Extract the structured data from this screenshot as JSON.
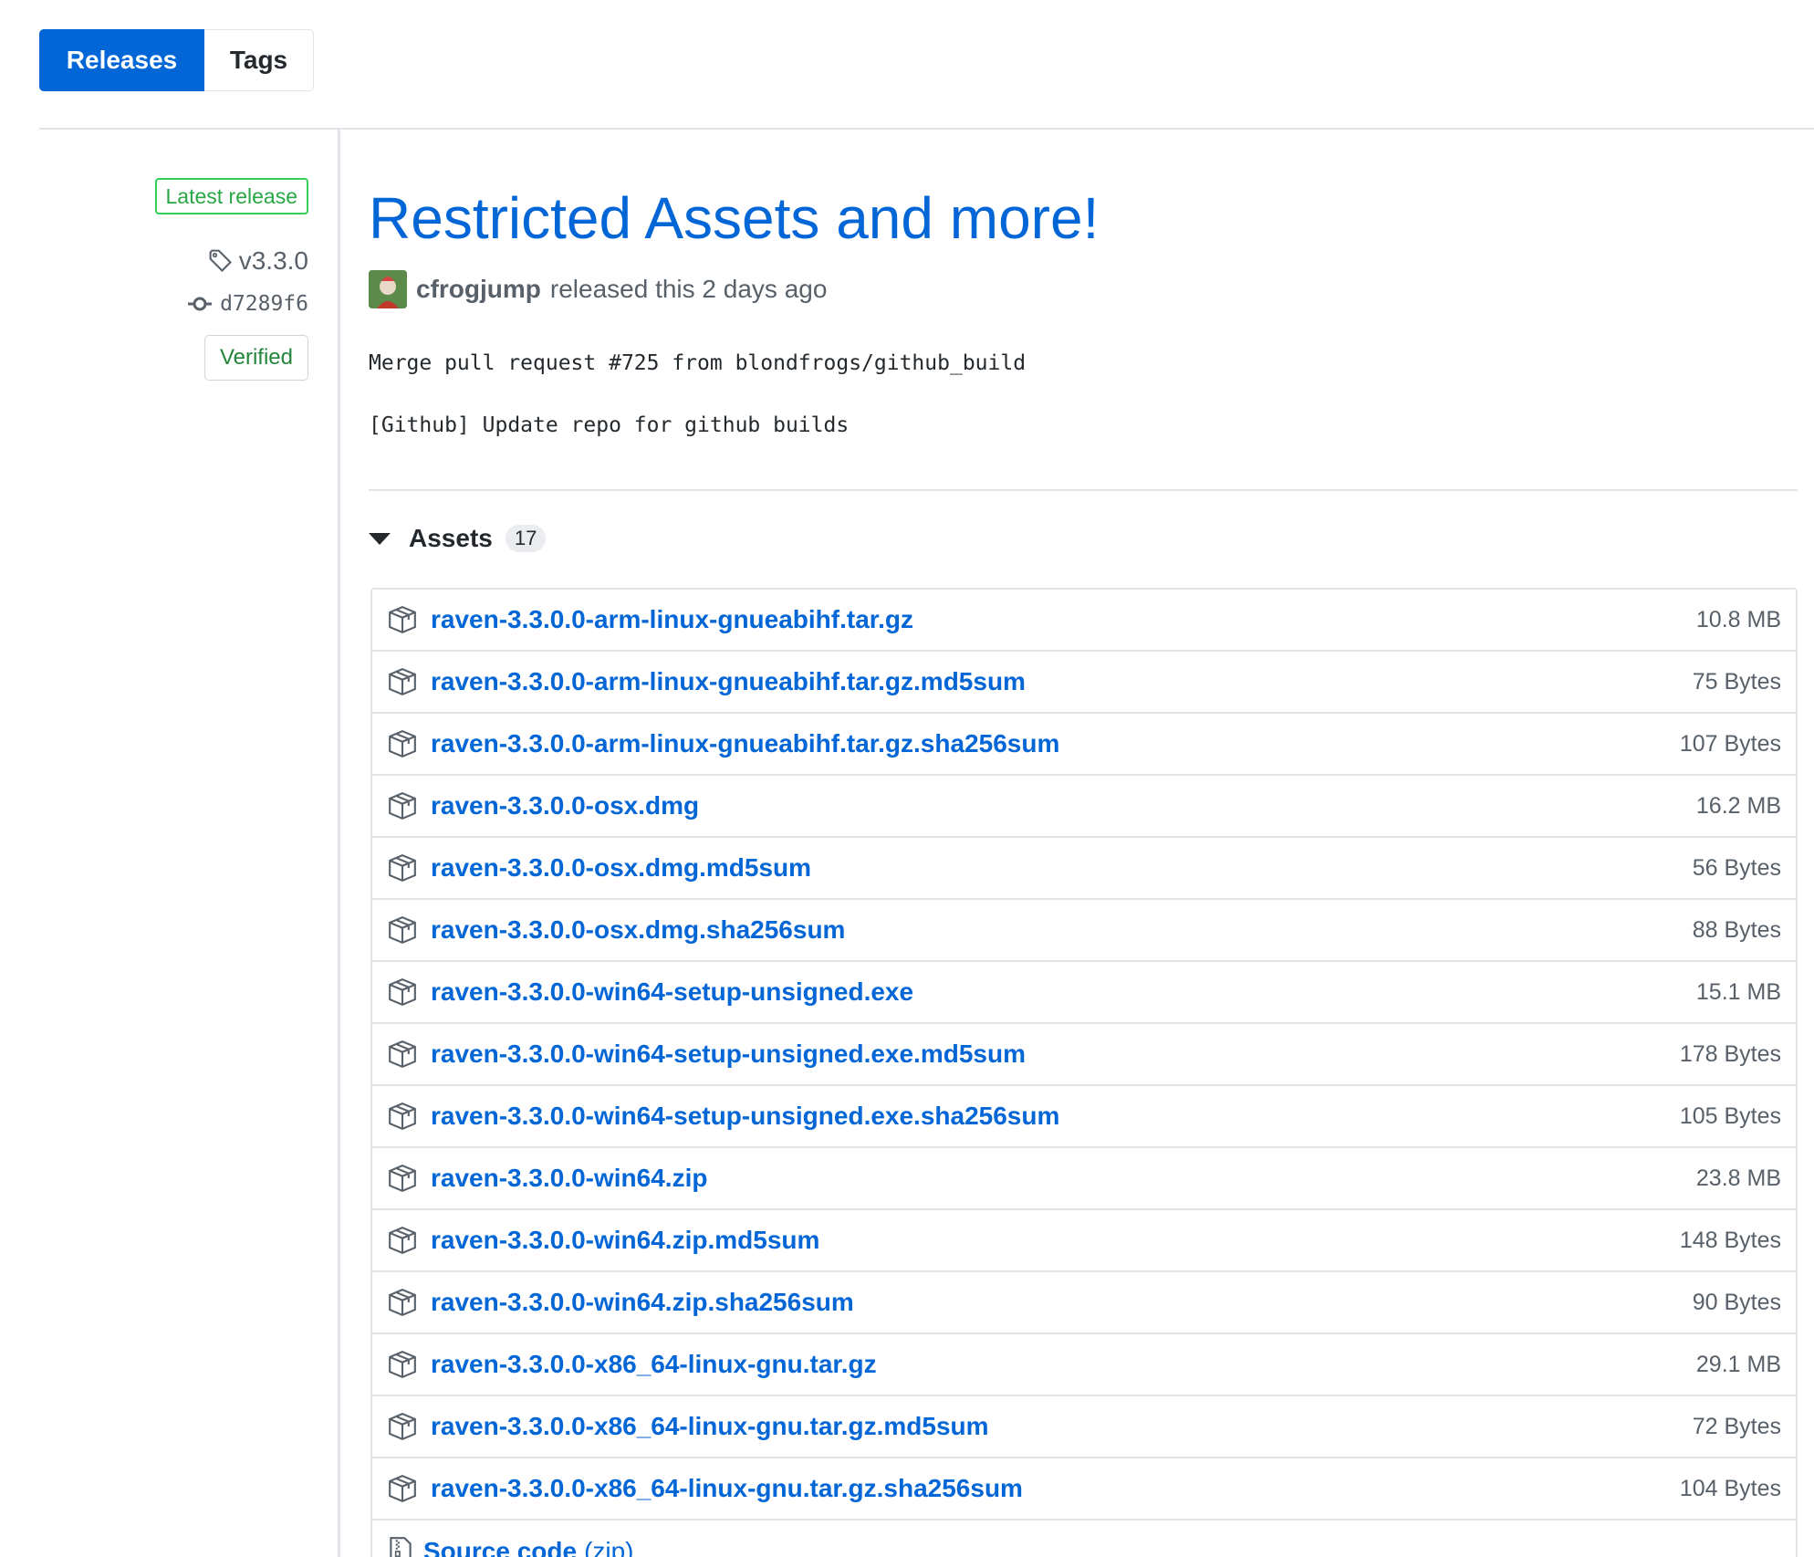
{
  "tabs": {
    "releases": "Releases",
    "tags": "Tags"
  },
  "sidebar": {
    "badge": "Latest release",
    "tag": "v3.3.0",
    "commit": "d7289f6",
    "verified": "Verified"
  },
  "release": {
    "title": "Restricted Assets and more!",
    "author": "cfrogjump",
    "released_text": "released this 2 days ago",
    "body_line1": "Merge pull request #725 from blondfrogs/github_build",
    "body_line2": "[Github] Update repo for github builds"
  },
  "assets": {
    "label": "Assets",
    "count": "17",
    "items": [
      {
        "name": "raven-3.3.0.0-arm-linux-gnueabihf.tar.gz",
        "size": "10.8 MB"
      },
      {
        "name": "raven-3.3.0.0-arm-linux-gnueabihf.tar.gz.md5sum",
        "size": "75 Bytes"
      },
      {
        "name": "raven-3.3.0.0-arm-linux-gnueabihf.tar.gz.sha256sum",
        "size": "107 Bytes"
      },
      {
        "name": "raven-3.3.0.0-osx.dmg",
        "size": "16.2 MB"
      },
      {
        "name": "raven-3.3.0.0-osx.dmg.md5sum",
        "size": "56 Bytes"
      },
      {
        "name": "raven-3.3.0.0-osx.dmg.sha256sum",
        "size": "88 Bytes"
      },
      {
        "name": "raven-3.3.0.0-win64-setup-unsigned.exe",
        "size": "15.1 MB"
      },
      {
        "name": "raven-3.3.0.0-win64-setup-unsigned.exe.md5sum",
        "size": "178 Bytes"
      },
      {
        "name": "raven-3.3.0.0-win64-setup-unsigned.exe.sha256sum",
        "size": "105 Bytes"
      },
      {
        "name": "raven-3.3.0.0-win64.zip",
        "size": "23.8 MB"
      },
      {
        "name": "raven-3.3.0.0-win64.zip.md5sum",
        "size": "148 Bytes"
      },
      {
        "name": "raven-3.3.0.0-win64.zip.sha256sum",
        "size": "90 Bytes"
      },
      {
        "name": "raven-3.3.0.0-x86_64-linux-gnu.tar.gz",
        "size": "29.1 MB"
      },
      {
        "name": "raven-3.3.0.0-x86_64-linux-gnu.tar.gz.md5sum",
        "size": "72 Bytes"
      },
      {
        "name": "raven-3.3.0.0-x86_64-linux-gnu.tar.gz.sha256sum",
        "size": "104 Bytes"
      }
    ],
    "source": {
      "name": "Source code",
      "sub": "(zip)"
    }
  },
  "colors": {
    "accent": "#0366d6",
    "latest_badge": "#28a745",
    "verified": "#22863a"
  },
  "icons": {
    "tag": "tag-icon",
    "commit": "commit-icon",
    "package": "package-icon",
    "zip": "file-zip-icon",
    "caret": "triangle-down-icon"
  }
}
